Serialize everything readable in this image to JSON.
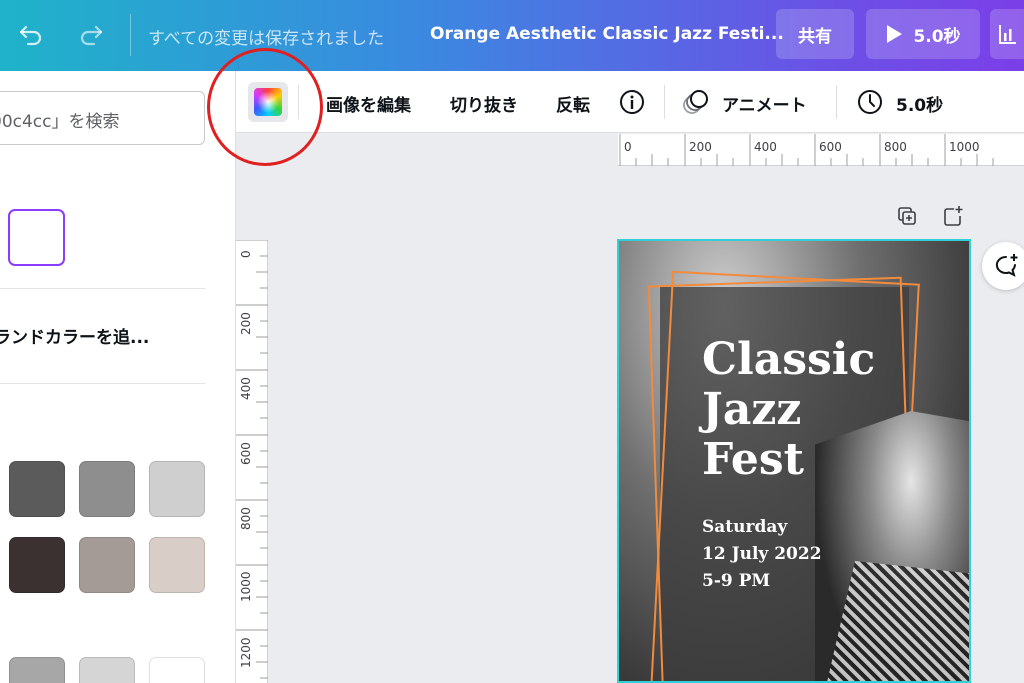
{
  "topbar": {
    "saved_status": "すべての変更は保存されました",
    "doc_title": "Orange Aesthetic Classic Jazz Festi...",
    "share_label": "共有",
    "play_label": "5.0秒"
  },
  "left_panel": {
    "search_placeholder": "00c4cc」を検索",
    "brand_color_label": "ランドカラーを追...",
    "swatches": [
      "#5b5b5b",
      "#8e8e8e",
      "#cfcfcf",
      "#3b3131",
      "#a59b96",
      "#d9cec7",
      "#a7a7a7",
      "#d5d5d5",
      "#ffffff"
    ],
    "selected_color": "#8b3dff"
  },
  "toolbar": {
    "edit_image": "画像を編集",
    "crop": "切り抜き",
    "flip": "反転",
    "animate": "アニメート",
    "duration": "5.0秒"
  },
  "rulers": {
    "top": [
      "0",
      "200",
      "400",
      "600",
      "800",
      "1000"
    ],
    "left": [
      "0",
      "200",
      "400",
      "600",
      "800",
      "1000",
      "1200"
    ]
  },
  "poster": {
    "title_lines": [
      "Classic",
      "Jazz",
      "Fest"
    ],
    "date_lines": [
      "Saturday",
      "12 July 2022",
      "5-9 PM"
    ],
    "accent": "#f28b3c",
    "selection_color": "#2fd0d6"
  }
}
